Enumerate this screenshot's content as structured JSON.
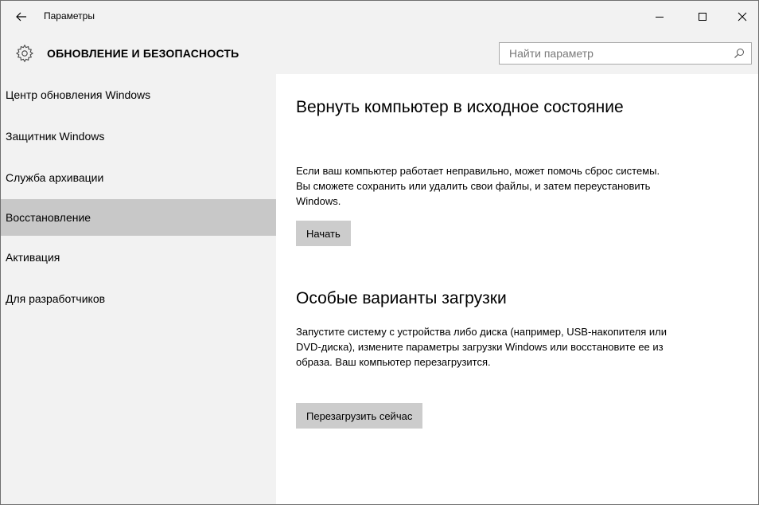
{
  "window": {
    "title": "Параметры",
    "back_icon": "arrow-left-icon",
    "controls": {
      "minimize": "minimize-icon",
      "maximize": "maximize-icon",
      "close": "close-icon"
    }
  },
  "header": {
    "icon": "gear-icon",
    "title": "ОБНОВЛЕНИЕ И БЕЗОПАСНОСТЬ",
    "search_placeholder": "Найти параметр",
    "search_icon": "search-icon"
  },
  "sidebar": {
    "items": [
      {
        "label": "Центр обновления Windows",
        "selected": false
      },
      {
        "label": "Защитник Windows",
        "selected": false
      },
      {
        "label": "Служба архивации",
        "selected": false
      },
      {
        "label": "Восстановление",
        "selected": true
      },
      {
        "label": "Активация",
        "selected": false
      },
      {
        "label": "Для разработчиков",
        "selected": false
      }
    ]
  },
  "main": {
    "reset": {
      "title": "Вернуть компьютер в исходное состояние",
      "description": "Если ваш компьютер работает неправильно, может помочь сброс системы. Вы сможете сохранить или удалить свои файлы, и затем переустановить Windows.",
      "button_label": "Начать"
    },
    "advanced_startup": {
      "title": "Особые варианты загрузки",
      "description": "Запустите систему с устройства либо диска (например, USB-накопителя или DVD-диска), измените параметры загрузки Windows или восстановите ее из образа. Ваш компьютер перезагрузится.",
      "button_label": "Перезагрузить сейчас"
    }
  },
  "colors": {
    "chrome_bg": "#f2f2f2",
    "selected_bg": "#c8c8c8",
    "button_bg": "#cccccc"
  }
}
